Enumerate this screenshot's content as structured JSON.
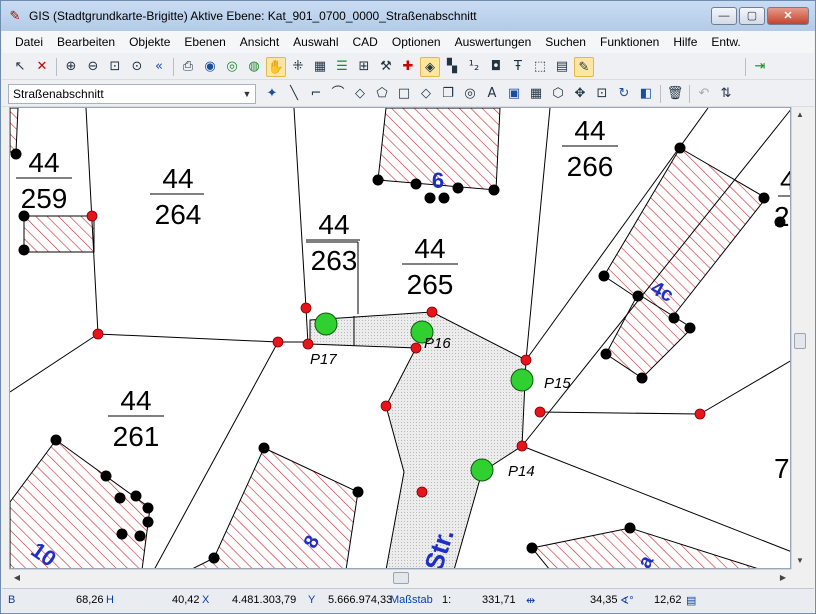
{
  "window": {
    "title": "GIS (Stadtgrundkarte-Brigitte) Aktive Ebene: Kat_901_0700_0000_Straßenabschnitt",
    "controls": {
      "minimize": "—",
      "maximize": "▢",
      "close": "✕"
    }
  },
  "menu": [
    "Datei",
    "Bearbeiten",
    "Objekte",
    "Ebenen",
    "Ansicht",
    "Auswahl",
    "CAD",
    "Optionen",
    "Auswertungen",
    "Suchen",
    "Funktionen",
    "Hilfe",
    "Entw."
  ],
  "toolbar2": {
    "layer_combo_value": "Straßenabschnitt",
    "label_tool": "A"
  },
  "map": {
    "parcel_labels": [
      {
        "top": "44",
        "bottom": "259"
      },
      {
        "top": "44",
        "bottom": "264"
      },
      {
        "top": "44",
        "bottom": "263"
      },
      {
        "top": "44",
        "bottom": "265"
      },
      {
        "top": "44",
        "bottom": "266"
      },
      {
        "top": "44",
        "bottom": "261"
      }
    ],
    "edge_labels": [
      "4",
      "2",
      "7"
    ],
    "house_numbers": [
      "6",
      "4c",
      "10",
      "8",
      "a"
    ],
    "street_label": "Str.",
    "point_labels": [
      "P17",
      "P16",
      "P15",
      "P14"
    ],
    "colors": {
      "building_hatch": "#d0242a",
      "street_fill": "#e6e6e6",
      "point_green": "#2fd02f",
      "vertex_red": "#e8141b",
      "vertex_black": "#000000",
      "label_blue": "#1d2fc4"
    }
  },
  "statusbar": {
    "mode": "B",
    "h_value": "68,26",
    "h_unit": "H",
    "x_value": "40,42",
    "x_unit": "X",
    "y_coord": "4.481.303,79",
    "y_unit": "Y",
    "r_coord": "5.666.974,33",
    "scale_label": "Maßstab",
    "scale_prefix": "1:",
    "scale_value": "331,71",
    "angle_value": "34,35",
    "angle_unit": "∢°",
    "size_value": "12,62"
  }
}
